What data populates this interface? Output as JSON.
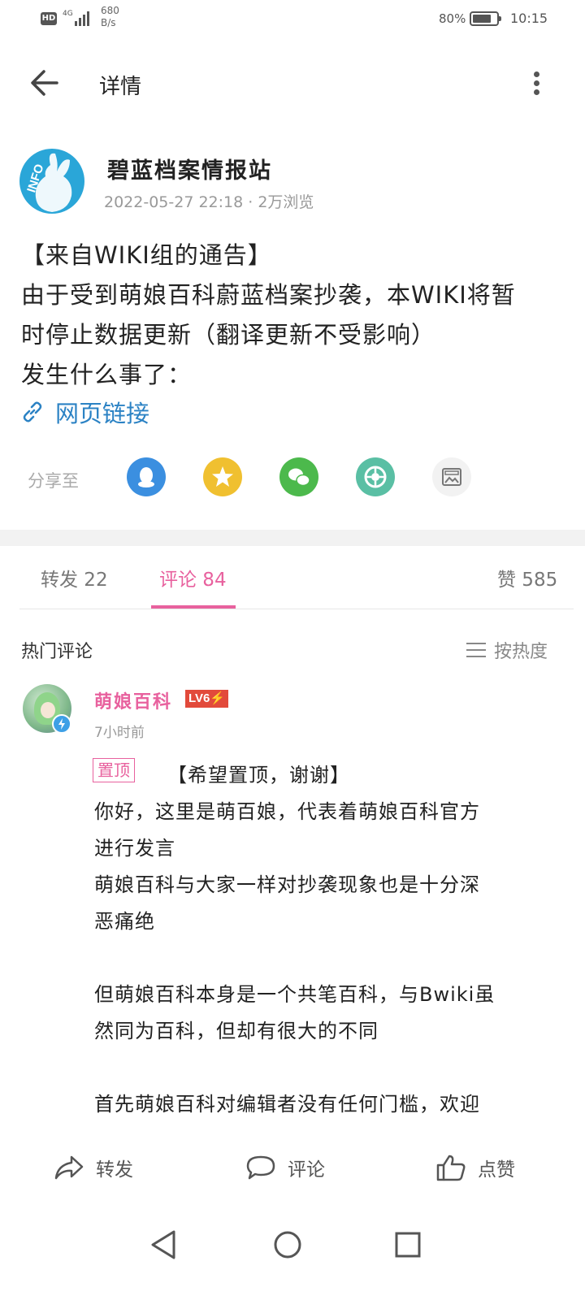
{
  "status_bar": {
    "hd": "HD",
    "network": "4G",
    "speed": "680\nB/s",
    "speed_value": "680",
    "speed_unit": "B/s",
    "battery_pct": "80%",
    "battery_level": 0.8,
    "time": "10:15"
  },
  "app_bar": {
    "title": "详情"
  },
  "post": {
    "author": "碧蓝档案情报站",
    "meta": "2022-05-27 22:18 · 2万浏览",
    "lines": [
      "【来自WIKI组的通告】",
      "由于受到萌娘百科蔚蓝档案抄袭，本WIKI将暂",
      "时停止数据更新（翻译更新不受影响）",
      "发生什么事了："
    ],
    "link_label": "网页链接",
    "avatar_text": "INFO"
  },
  "share": {
    "label": "分享至",
    "targets": [
      {
        "icon": "qq-icon",
        "color": "#3b8fe0"
      },
      {
        "icon": "qzone-star-icon",
        "color": "#f0c030"
      },
      {
        "icon": "wechat-icon",
        "color": "#4cb94c"
      },
      {
        "icon": "moments-icon",
        "color": "#5abfa4"
      },
      {
        "icon": "image-share-icon",
        "color": "#f2f2f2"
      }
    ]
  },
  "tabs": {
    "repost": "转发 22",
    "comments": "评论 84",
    "likes": "赞 585"
  },
  "comments_header": {
    "label": "热门评论",
    "sort": "按热度"
  },
  "comment": {
    "name": "萌娘百科",
    "level": "LV6",
    "time": "7小时前",
    "pin": "置顶",
    "lines": [
      "【希望置顶，谢谢】",
      "你好，这里是萌百娘，代表着萌娘百科官方",
      "进行发言",
      "萌娘百科与大家一样对抄袭现象也是十分深",
      "恶痛绝",
      "",
      "但萌娘百科本身是一个共笔百科，与Bwiki虽",
      "然同为百科，但却有很大的不同",
      "",
      "首先萌娘百科对编辑者没有任何门槛，欢迎"
    ]
  },
  "actions": {
    "repost": "转发",
    "comment": "评论",
    "like": "点赞"
  },
  "colors": {
    "accent": "#e8619e",
    "link": "#2b82c4"
  }
}
